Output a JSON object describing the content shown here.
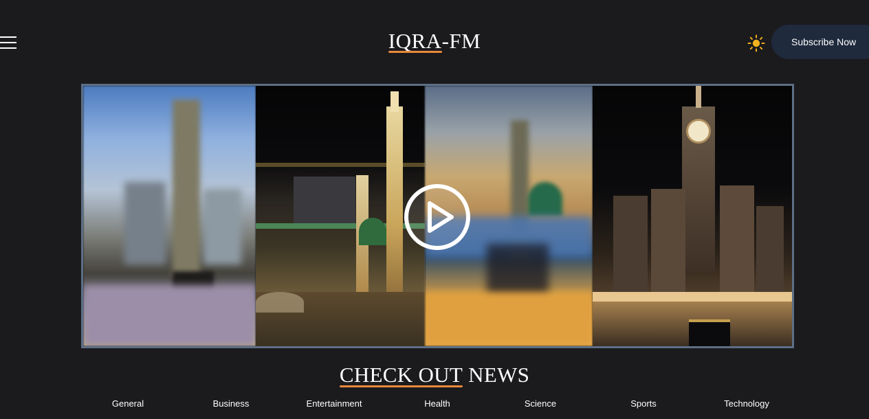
{
  "header": {
    "logo_part1": "IQRA",
    "logo_part2": "-FM",
    "subscribe_label": "Subscribe Now"
  },
  "hero": {
    "panels": [
      "blurred-clock-tower-panel",
      "mosque-night-panel",
      "blurred-mosque-dusk-panel",
      "clock-tower-night-panel"
    ],
    "play_icon": "play-icon"
  },
  "news": {
    "title_part1": "CHECK OUT",
    "title_part2": " NEWS",
    "categories": [
      "General",
      "Business",
      "Entertainment",
      "Health",
      "Science",
      "Sports",
      "Technology"
    ]
  },
  "colors": {
    "background": "#1b1a1d",
    "accent_underline": "#e8893a",
    "subscribe_bg": "#1f2a3d",
    "sun_icon": "#f2b11d",
    "hero_border": "#5d6f86"
  }
}
